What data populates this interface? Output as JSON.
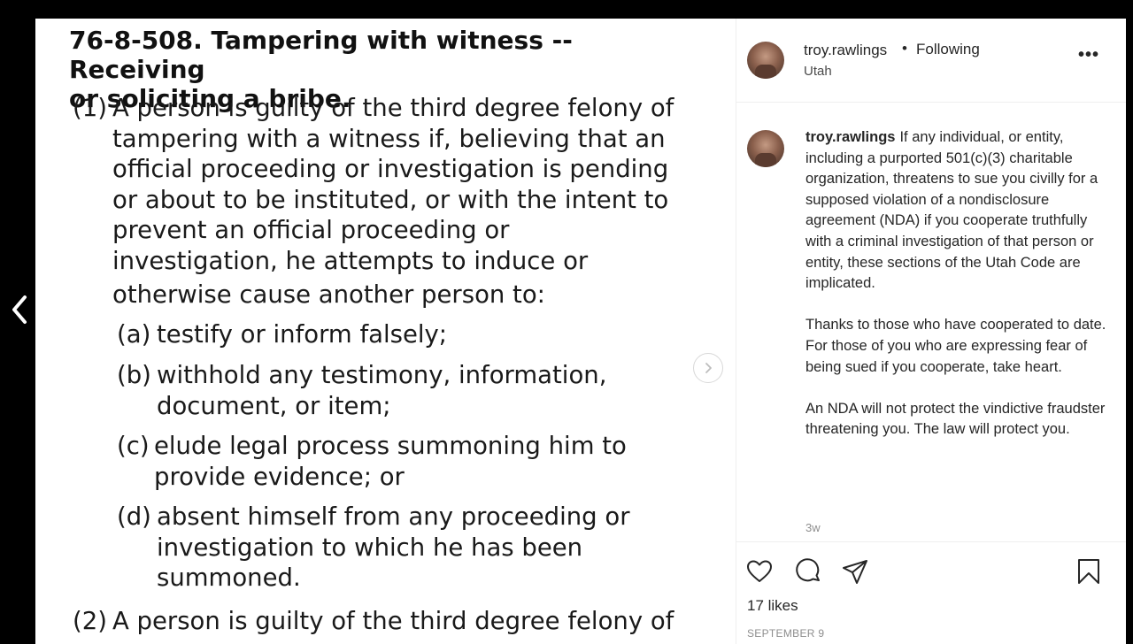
{
  "post_image": {
    "title_line1": "76-8-508.  Tampering with witness -- Receiving",
    "title_line2": "or soliciting a bribe.",
    "p1_num": "(1)",
    "p1_lines": [
      "A person is guilty of the third degree felony of",
      "tampering with a witness if, believing that an",
      "official proceeding or investigation is pending",
      "or about to be instituted, or with the intent to",
      "prevent an official proceeding or",
      "investigation, he attempts to induce or"
    ],
    "p1_last": "otherwise cause another person to:",
    "sub_a": {
      "label": "(a)",
      "lines": [
        "testify or inform falsely;"
      ]
    },
    "sub_b": {
      "label": "(b)",
      "lines": [
        "withhold any testimony, information,",
        "document, or item;"
      ]
    },
    "sub_c": {
      "label": "(c)",
      "lines": [
        "elude legal process summoning him to",
        "provide evidence; or"
      ]
    },
    "sub_d": {
      "label": "(d)",
      "lines": [
        "absent himself from any proceeding or",
        "investigation to which he has been",
        "summoned."
      ]
    },
    "p2_num": "(2)",
    "p2_line": "A person is guilty of the third degree felony of"
  },
  "header": {
    "username": "troy.rawlings",
    "separator": "•",
    "follow_status": "Following",
    "location": "Utah",
    "more": "•••"
  },
  "caption": {
    "username": "troy.rawlings",
    "para1": "If any individual, or entity, including a purported 501(c)(3) charitable organization, threatens to sue you civilly for a supposed violation of a nondisclosure agreement (NDA) if you cooperate truthfully with a criminal investigation of that person or entity, these sections of the Utah Code are implicated.",
    "para2": "Thanks to those who have cooperated to date. For those of you who are expressing fear of being sued if you cooperate, take heart.",
    "para3": "An NDA will not protect the vindictive fraudster threatening you. The law will protect you.",
    "time_ago": "3w"
  },
  "footer": {
    "likes": "17 likes",
    "date": "SEPTEMBER 9"
  },
  "icons": [
    "chevron-left-icon",
    "chevron-right-icon",
    "heart-icon",
    "comment-icon",
    "share-icon",
    "bookmark-icon",
    "more-icon"
  ]
}
